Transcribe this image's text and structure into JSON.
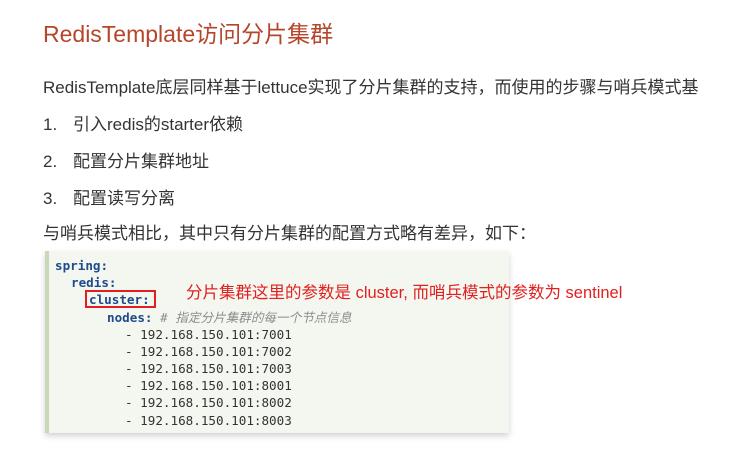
{
  "title": "RedisTemplate访问分片集群",
  "paragraph": "RedisTemplate底层同样基于lettuce实现了分片集群的支持，而使用的步骤与哨兵模式基",
  "steps": [
    {
      "num": "1.",
      "text": "引入redis的starter依赖"
    },
    {
      "num": "2.",
      "text": "配置分片集群地址"
    },
    {
      "num": "3.",
      "text": "配置读写分离"
    }
  ],
  "intro2": "与哨兵模式相比，其中只有分片集群的配置方式略有差异，如下：",
  "code": {
    "spring_key": "spring:",
    "redis_key": "redis:",
    "cluster_key": "cluster:",
    "nodes_key": "nodes:",
    "nodes_comment": "# 指定分片集群的每一个节点信息",
    "nodes": [
      "- 192.168.150.101:7001",
      "- 192.168.150.101:7002",
      "- 192.168.150.101:7003",
      "- 192.168.150.101:8001",
      "- 192.168.150.101:8002",
      "- 192.168.150.101:8003"
    ]
  },
  "annotation": "分片集群这里的参数是 cluster, 而哨兵模式的参数为 sentinel",
  "colors": {
    "title": "#b5462b",
    "annotation": "#e02020",
    "code_key": "#1f4a8c",
    "code_bg": "#f4f7f0"
  }
}
